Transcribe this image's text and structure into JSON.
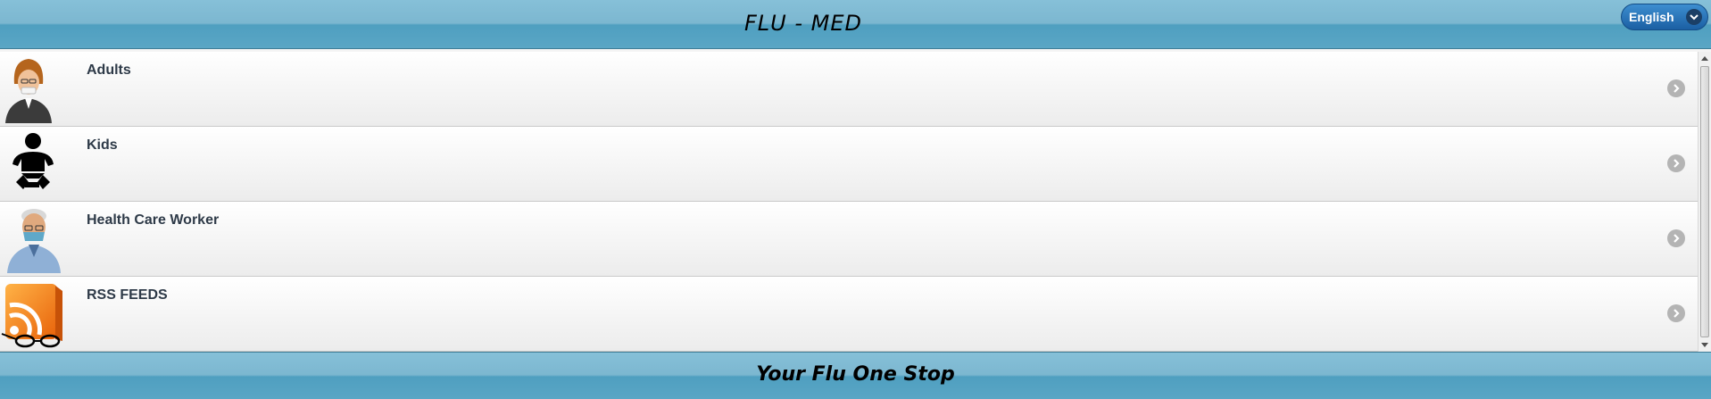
{
  "header": {
    "title": "FLU - MED",
    "language": {
      "selected": "English",
      "icon": "chevron-down-icon"
    }
  },
  "list": {
    "items": [
      {
        "label": "Adults",
        "icon": "adult-woman-icon"
      },
      {
        "label": "Kids",
        "icon": "baby-icon"
      },
      {
        "label": "Health Care Worker",
        "icon": "masked-doctor-icon"
      },
      {
        "label": "RSS FEEDS",
        "icon": "rss-feed-icon"
      }
    ],
    "arrow_icon": "chevron-right-icon"
  },
  "footer": {
    "text": "Your Flu One Stop"
  },
  "colors": {
    "header_bar": "#5aa6c5",
    "language_button": "#1b5fa3",
    "list_label": "#2e3a48",
    "arrow_circle": "#b4b4b4"
  }
}
